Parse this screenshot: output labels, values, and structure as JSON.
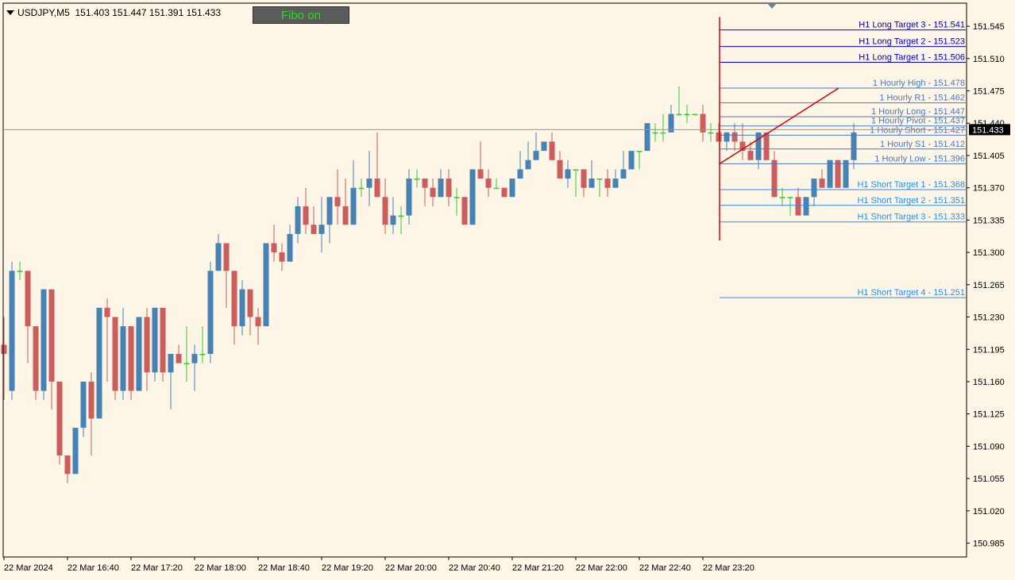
{
  "header": {
    "symbol": "USDJPY,M5",
    "ohlc": "151.403 151.447 151.391 151.433",
    "fibo_button": "Fibo on"
  },
  "colors": {
    "background": "#fdf5e6",
    "bull": "#4682b4",
    "bear": "#cd5c5c",
    "doji": "#32cd32",
    "long_targets": "#0000cd",
    "hourly": "#4a78c6",
    "short_targets": "#1e90ff",
    "trend_line": "#e00000",
    "price_label_bg": "#000000"
  },
  "chart_data": {
    "type": "candlestick",
    "title": "USDJPY,M5",
    "current_price": "151.433",
    "ylim": [
      150.97,
      151.57
    ],
    "y_ticks": [
      "151.545",
      "151.510",
      "151.475",
      "151.440",
      "151.405",
      "151.370",
      "151.335",
      "151.300",
      "151.265",
      "151.230",
      "151.195",
      "151.160",
      "151.125",
      "151.090",
      "151.055",
      "151.020",
      "150.985"
    ],
    "x_ticks": [
      "22 Mar 2024",
      "22 Mar 16:40",
      "22 Mar 17:20",
      "22 Mar 18:00",
      "22 Mar 18:40",
      "22 Mar 19:20",
      "22 Mar 20:00",
      "22 Mar 20:40",
      "22 Mar 21:20",
      "22 Mar 22:00",
      "22 Mar 22:40",
      "22 Mar 23:20"
    ],
    "candles": [
      [
        151.2,
        151.19,
        151.23,
        151.14
      ],
      [
        151.15,
        151.28,
        151.29,
        151.14
      ],
      [
        151.28,
        151.28,
        151.29,
        151.27
      ],
      [
        151.28,
        151.22,
        151.28,
        151.18
      ],
      [
        151.22,
        151.15,
        151.22,
        151.14
      ],
      [
        151.15,
        151.26,
        151.26,
        151.14
      ],
      [
        151.26,
        151.16,
        151.26,
        151.13
      ],
      [
        151.16,
        151.08,
        151.16,
        151.07
      ],
      [
        151.08,
        151.06,
        151.08,
        151.05
      ],
      [
        151.06,
        151.11,
        151.11,
        151.06
      ],
      [
        151.11,
        151.16,
        151.16,
        151.1
      ],
      [
        151.16,
        151.12,
        151.17,
        151.08
      ],
      [
        151.12,
        151.24,
        151.24,
        151.12
      ],
      [
        151.24,
        151.23,
        151.25,
        151.16
      ],
      [
        151.23,
        151.15,
        151.23,
        151.14
      ],
      [
        151.15,
        151.22,
        151.24,
        151.14
      ],
      [
        151.22,
        151.15,
        151.22,
        151.14
      ],
      [
        151.15,
        151.23,
        151.23,
        151.15
      ],
      [
        151.23,
        151.17,
        151.24,
        151.15
      ],
      [
        151.17,
        151.24,
        151.24,
        151.16
      ],
      [
        151.24,
        151.17,
        151.24,
        151.16
      ],
      [
        151.17,
        151.19,
        151.19,
        151.13
      ],
      [
        151.19,
        151.18,
        151.2,
        151.18
      ],
      [
        151.18,
        151.18,
        151.22,
        151.16
      ],
      [
        151.18,
        151.19,
        151.2,
        151.15
      ],
      [
        151.19,
        151.19,
        151.22,
        151.18
      ],
      [
        151.19,
        151.28,
        151.29,
        151.18
      ],
      [
        151.28,
        151.31,
        151.32,
        151.28
      ],
      [
        151.31,
        151.28,
        151.31,
        151.24
      ],
      [
        151.28,
        151.22,
        151.28,
        151.2
      ],
      [
        151.22,
        151.26,
        151.27,
        151.21
      ],
      [
        151.26,
        151.23,
        151.26,
        151.21
      ],
      [
        151.23,
        151.22,
        151.24,
        151.2
      ],
      [
        151.22,
        151.31,
        151.31,
        151.22
      ],
      [
        151.31,
        151.3,
        151.33,
        151.29
      ],
      [
        151.3,
        151.29,
        151.31,
        151.28
      ],
      [
        151.29,
        151.32,
        151.33,
        151.29
      ],
      [
        151.32,
        151.35,
        151.36,
        151.31
      ],
      [
        151.35,
        151.33,
        151.37,
        151.32
      ],
      [
        151.33,
        151.32,
        151.35,
        151.32
      ],
      [
        151.32,
        151.33,
        151.36,
        151.3
      ],
      [
        151.33,
        151.36,
        151.36,
        151.31
      ],
      [
        151.36,
        151.35,
        151.39,
        151.33
      ],
      [
        151.35,
        151.33,
        151.38,
        151.33
      ],
      [
        151.33,
        151.37,
        151.4,
        151.37
      ],
      [
        151.37,
        151.37,
        151.38,
        151.36
      ],
      [
        151.37,
        151.38,
        151.41,
        151.35
      ],
      [
        151.38,
        151.36,
        151.43,
        151.36
      ],
      [
        151.36,
        151.33,
        151.38,
        151.32
      ],
      [
        151.33,
        151.34,
        151.36,
        151.32
      ],
      [
        151.34,
        151.34,
        151.35,
        151.32
      ],
      [
        151.34,
        151.38,
        151.39,
        151.33
      ],
      [
        151.38,
        151.38,
        151.39,
        151.37
      ],
      [
        151.38,
        151.37,
        151.38,
        151.35
      ],
      [
        151.37,
        151.36,
        151.38,
        151.35
      ],
      [
        151.36,
        151.38,
        151.39,
        151.36
      ],
      [
        151.38,
        151.36,
        151.39,
        151.35
      ],
      [
        151.36,
        151.36,
        151.37,
        151.34
      ],
      [
        151.36,
        151.33,
        151.36,
        151.34
      ],
      [
        151.33,
        151.39,
        151.39,
        151.33
      ],
      [
        151.39,
        151.38,
        151.42,
        151.38
      ],
      [
        151.38,
        151.37,
        151.39,
        151.36
      ],
      [
        151.37,
        151.37,
        151.38,
        151.37
      ],
      [
        151.37,
        151.36,
        151.37,
        151.36
      ],
      [
        151.36,
        151.38,
        151.38,
        151.37
      ],
      [
        151.38,
        151.39,
        151.41,
        151.38
      ],
      [
        151.39,
        151.4,
        151.42,
        151.39
      ],
      [
        151.4,
        151.41,
        151.43,
        151.4
      ],
      [
        151.41,
        151.42,
        151.42,
        151.41
      ],
      [
        151.42,
        151.4,
        151.43,
        151.4
      ],
      [
        151.4,
        151.38,
        151.41,
        151.38
      ],
      [
        151.38,
        151.39,
        151.4,
        151.37
      ],
      [
        151.39,
        151.39,
        151.39,
        151.36
      ],
      [
        151.39,
        151.37,
        151.39,
        151.36
      ],
      [
        151.37,
        151.38,
        151.4,
        151.37
      ],
      [
        151.38,
        151.38,
        151.38,
        151.36
      ],
      [
        151.38,
        151.37,
        151.39,
        151.36
      ],
      [
        151.37,
        151.38,
        151.39,
        151.38
      ],
      [
        151.38,
        151.39,
        151.41,
        151.39
      ],
      [
        151.39,
        151.41,
        151.41,
        151.4
      ],
      [
        151.41,
        151.41,
        151.41,
        151.39
      ],
      [
        151.41,
        151.44,
        151.44,
        151.42
      ],
      [
        151.43,
        151.43,
        151.44,
        151.42
      ],
      [
        151.43,
        151.43,
        151.45,
        151.42
      ],
      [
        151.43,
        151.45,
        151.46,
        151.44
      ],
      [
        151.45,
        151.45,
        151.48,
        151.45
      ],
      [
        151.45,
        151.45,
        151.46,
        151.44
      ],
      [
        151.45,
        151.45,
        151.45,
        151.45
      ],
      [
        151.45,
        151.43,
        151.46,
        151.42
      ],
      [
        151.43,
        151.43,
        151.44,
        151.42
      ],
      [
        151.43,
        151.42,
        151.44,
        151.42
      ],
      [
        151.42,
        151.43,
        151.43,
        151.41
      ],
      [
        151.43,
        151.42,
        151.44,
        151.41
      ],
      [
        151.42,
        151.41,
        151.44,
        151.4
      ],
      [
        151.41,
        151.4,
        151.42,
        151.4
      ],
      [
        151.4,
        151.43,
        151.43,
        151.39
      ],
      [
        151.43,
        151.4,
        151.43,
        151.4
      ],
      [
        151.4,
        151.36,
        151.41,
        151.36
      ],
      [
        151.36,
        151.36,
        151.37,
        151.35
      ],
      [
        151.36,
        151.36,
        151.36,
        151.34
      ],
      [
        151.36,
        151.34,
        151.37,
        151.34
      ],
      [
        151.34,
        151.36,
        151.36,
        151.34
      ],
      [
        151.36,
        151.38,
        151.38,
        151.35
      ],
      [
        151.38,
        151.37,
        151.39,
        151.37
      ],
      [
        151.37,
        151.4,
        151.4,
        151.37
      ],
      [
        151.4,
        151.37,
        151.4,
        151.37
      ],
      [
        151.37,
        151.4,
        151.4,
        151.37
      ],
      [
        151.4,
        151.43,
        151.44,
        151.39
      ]
    ],
    "levels": [
      {
        "label": "H1 Long Target 3 -  151.541",
        "price": 151.541,
        "group": "long"
      },
      {
        "label": "H1 Long Target 2 -  151.523",
        "price": 151.523,
        "group": "long"
      },
      {
        "label": "H1 Long Target 1 -  151.506",
        "price": 151.506,
        "group": "long"
      },
      {
        "label": "1 Hourly High -  151.478",
        "price": 151.478,
        "group": "hourly"
      },
      {
        "label": "1 Hourly R1 -  151.462",
        "price": 151.462,
        "group": "hourly"
      },
      {
        "label": "1 Hourly Long -  151.447",
        "price": 151.447,
        "group": "hourly"
      },
      {
        "label": "1 Hourly Pivot -  151.437",
        "price": 151.437,
        "group": "hourly"
      },
      {
        "label": "1 Hourly Short -  151.427",
        "price": 151.427,
        "group": "hourly"
      },
      {
        "label": "1 Hourly S1 -  151.412",
        "price": 151.412,
        "group": "hourly"
      },
      {
        "label": "1 Hourly Low -  151.396",
        "price": 151.396,
        "group": "hourly"
      },
      {
        "label": "H1 Short Target 1 -  151.368",
        "price": 151.368,
        "group": "short"
      },
      {
        "label": "H1 Short Target 2 -  151.351",
        "price": 151.351,
        "group": "short"
      },
      {
        "label": "H1 Short Target 3 -  151.333",
        "price": 151.333,
        "group": "short"
      },
      {
        "label": "H1 Short Target 4 -  151.251",
        "price": 151.251,
        "group": "short"
      }
    ],
    "level_start_candle": 90,
    "trend_line": {
      "from_candle": 90,
      "from_price": 151.396,
      "to_candle": 105,
      "to_price": 151.478
    },
    "vertical_line": {
      "candle": 90,
      "from_price": 151.555,
      "to_price": 151.313
    }
  }
}
